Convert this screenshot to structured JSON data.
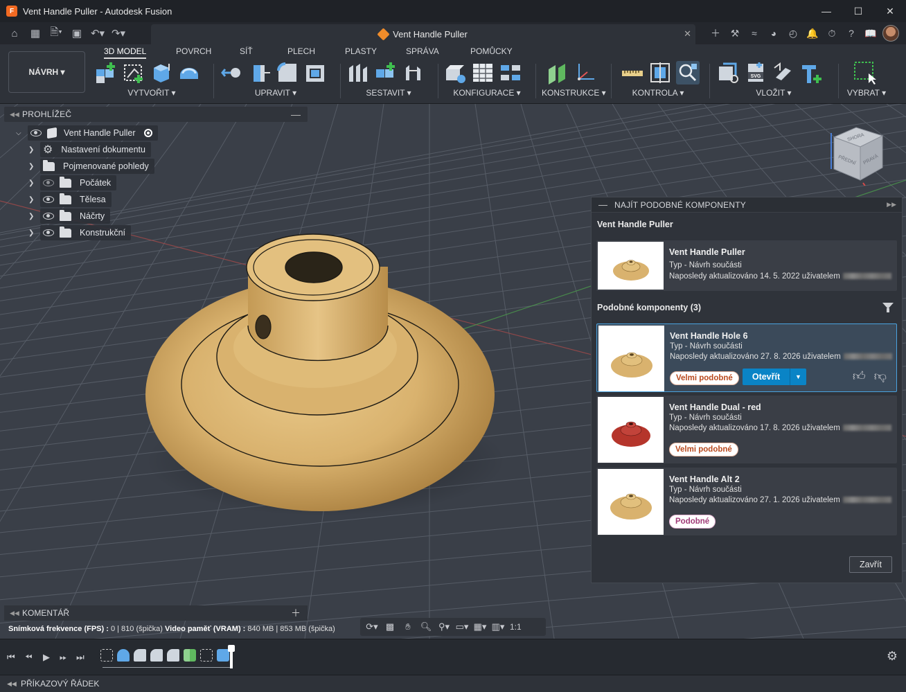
{
  "window": {
    "title": "Vent Handle Puller - Autodesk Fusion",
    "app_logo": "F",
    "doc_tab": "Vent Handle Puller"
  },
  "quick_access": [
    "home-icon",
    "grid-icon",
    "file-icon",
    "save-icon",
    "undo-icon",
    "redo-icon"
  ],
  "ribbon": {
    "workspace": "NÁVRH",
    "tabs": [
      "3D MODEL",
      "POVRCH",
      "SÍŤ",
      "PLECH",
      "PLASTY",
      "SPRÁVA",
      "POMŮCKY"
    ],
    "groups": {
      "create": "VYTVOŘIT",
      "modify": "UPRAVIT",
      "assemble": "SESTAVIT",
      "configure": "KONFIGURACE",
      "construct": "KONSTRUKCE",
      "inspect": "KONTROLA",
      "insert": "VLOŽIT",
      "select": "VYBRAT"
    }
  },
  "browser": {
    "title": "PROHLÍŽEČ",
    "root": "Vent Handle Puller",
    "items": [
      {
        "label": "Nastavení dokumentu",
        "icon": "gear-icon"
      },
      {
        "label": "Pojmenované pohledy",
        "icon": "folder-icon"
      },
      {
        "label": "Počátek",
        "icon": "folder-icon",
        "visible": false
      },
      {
        "label": "Tělesa",
        "icon": "folder-icon",
        "visible": true
      },
      {
        "label": "Náčrty",
        "icon": "folder-icon",
        "visible": true
      },
      {
        "label": "Konstrukční",
        "icon": "folder-icon",
        "visible": true
      }
    ]
  },
  "viewcube": {
    "front": "PŘEDNÍ",
    "right": "PRAVÁ",
    "top": "SHORA"
  },
  "find_similar": {
    "title": "NAJÍT PODOBNÉ KOMPONENTY",
    "source_heading": "Vent Handle Puller",
    "source": {
      "name": "Vent Handle Puller",
      "type": "Typ - Návrh součásti",
      "updated": "Naposledy aktualizováno 14. 5. 2022 uživatelem"
    },
    "similar_heading": "Podobné komponenty (3)",
    "results": [
      {
        "name": "Vent Handle Hole 6",
        "type": "Typ - Návrh součásti",
        "updated": "Naposledy aktualizováno 27. 8. 2026 uživatelem",
        "badge": "Velmi podobné",
        "color": "#d9b26e"
      },
      {
        "name": "Vent Handle Dual - red",
        "type": "Typ - Návrh součásti",
        "updated": "Naposledy aktualizováno 17. 8. 2026 uživatelem",
        "badge": "Velmi podobné",
        "color": "#b5352b"
      },
      {
        "name": "Vent Handle Alt 2",
        "type": "Typ - Návrh součásti",
        "updated": "Naposledy aktualizováno 27. 1. 2026 uživatelem",
        "badge": "Podobné",
        "color": "#d9b26e"
      }
    ],
    "open_label": "Otevřít",
    "close_label": "Zavřít"
  },
  "comment": {
    "title": "KOMENTÁŘ"
  },
  "status": {
    "fps_label": "Snímková frekvence (FPS) :",
    "fps_value": "0 | 810 (špička)",
    "vram_label": "Video paměť (VRAM) :",
    "vram_value": "840 MB | 853 MB (špička)",
    "scale": "1:1"
  },
  "command_line": "PŘÍKAZOVÝ ŘÁDEK",
  "colors": {
    "accent": "#0a84c6",
    "model": "#d9b26e",
    "background": "#3a3f48"
  }
}
